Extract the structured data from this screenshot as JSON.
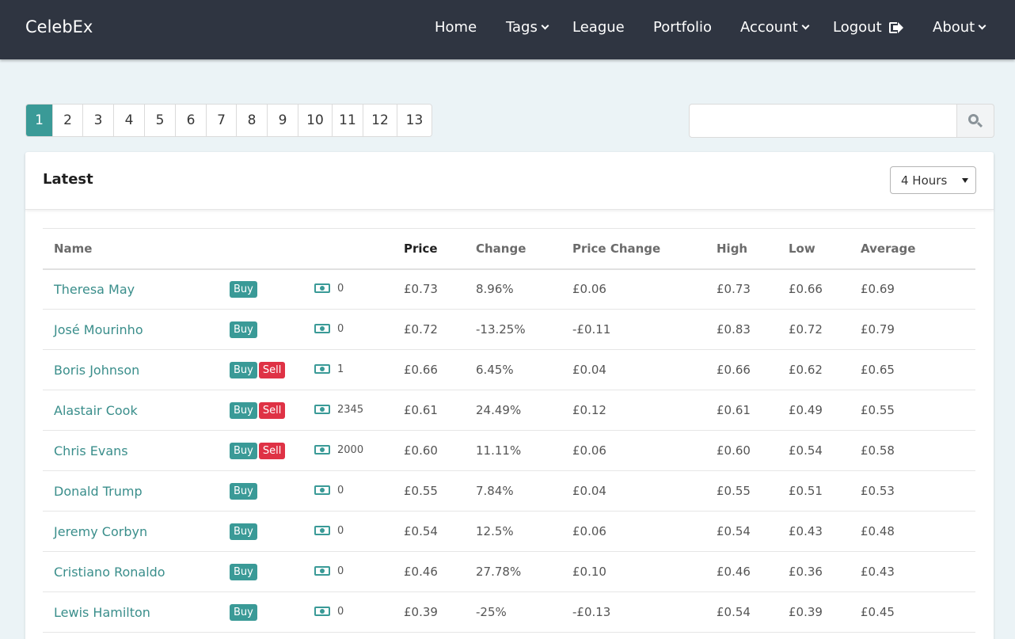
{
  "navbar": {
    "brand": "CelebEx",
    "items": [
      {
        "label": "Home",
        "has_dropdown": false
      },
      {
        "label": "Tags",
        "has_dropdown": true
      },
      {
        "label": "League",
        "has_dropdown": false
      },
      {
        "label": "Portfolio",
        "has_dropdown": false
      },
      {
        "label": "Account",
        "has_dropdown": true
      },
      {
        "label": "Logout",
        "icon": "sign-out-icon"
      },
      {
        "label": "About",
        "has_dropdown": true
      }
    ]
  },
  "pagination": {
    "pages": [
      "1",
      "2",
      "3",
      "4",
      "5",
      "6",
      "7",
      "8",
      "9",
      "10",
      "11",
      "12",
      "13"
    ],
    "active": "1"
  },
  "search": {
    "value": "",
    "placeholder": "",
    "icon": "search-icon"
  },
  "card": {
    "title": "Latest",
    "period_select": {
      "selected": "4 Hours"
    }
  },
  "table": {
    "headers": {
      "name": "Name",
      "price": "Price",
      "change": "Change",
      "price_change": "Price Change",
      "high": "High",
      "low": "Low",
      "average": "Average"
    },
    "rows": [
      {
        "name": "Theresa May",
        "buy": "Buy",
        "sell": "",
        "holdings": "0",
        "price": "£0.73",
        "change": "8.96%",
        "price_change": "£0.06",
        "high": "£0.73",
        "low": "£0.66",
        "average": "£0.69"
      },
      {
        "name": "José Mourinho",
        "buy": "Buy",
        "sell": "",
        "holdings": "0",
        "price": "£0.72",
        "change": "-13.25%",
        "price_change": "-£0.11",
        "high": "£0.83",
        "low": "£0.72",
        "average": "£0.79"
      },
      {
        "name": "Boris Johnson",
        "buy": "Buy",
        "sell": "Sell",
        "holdings": "1",
        "price": "£0.66",
        "change": "6.45%",
        "price_change": "£0.04",
        "high": "£0.66",
        "low": "£0.62",
        "average": "£0.65"
      },
      {
        "name": "Alastair Cook",
        "buy": "Buy",
        "sell": "Sell",
        "holdings": "2345",
        "price": "£0.61",
        "change": "24.49%",
        "price_change": "£0.12",
        "high": "£0.61",
        "low": "£0.49",
        "average": "£0.55"
      },
      {
        "name": "Chris Evans",
        "buy": "Buy",
        "sell": "Sell",
        "holdings": "2000",
        "price": "£0.60",
        "change": "11.11%",
        "price_change": "£0.06",
        "high": "£0.60",
        "low": "£0.54",
        "average": "£0.58"
      },
      {
        "name": "Donald Trump",
        "buy": "Buy",
        "sell": "",
        "holdings": "0",
        "price": "£0.55",
        "change": "7.84%",
        "price_change": "£0.04",
        "high": "£0.55",
        "low": "£0.51",
        "average": "£0.53"
      },
      {
        "name": "Jeremy Corbyn",
        "buy": "Buy",
        "sell": "",
        "holdings": "0",
        "price": "£0.54",
        "change": "12.5%",
        "price_change": "£0.06",
        "high": "£0.54",
        "low": "£0.43",
        "average": "£0.48"
      },
      {
        "name": "Cristiano Ronaldo",
        "buy": "Buy",
        "sell": "",
        "holdings": "0",
        "price": "£0.46",
        "change": "27.78%",
        "price_change": "£0.10",
        "high": "£0.46",
        "low": "£0.36",
        "average": "£0.43"
      },
      {
        "name": "Lewis Hamilton",
        "buy": "Buy",
        "sell": "",
        "holdings": "0",
        "price": "£0.39",
        "change": "-25%",
        "price_change": "-£0.13",
        "high": "£0.54",
        "low": "£0.39",
        "average": "£0.45"
      }
    ]
  },
  "colors": {
    "navbar": "#2f3541",
    "accent": "#3a9a97",
    "sell": "#df3245",
    "background": "#ebf3f6"
  }
}
